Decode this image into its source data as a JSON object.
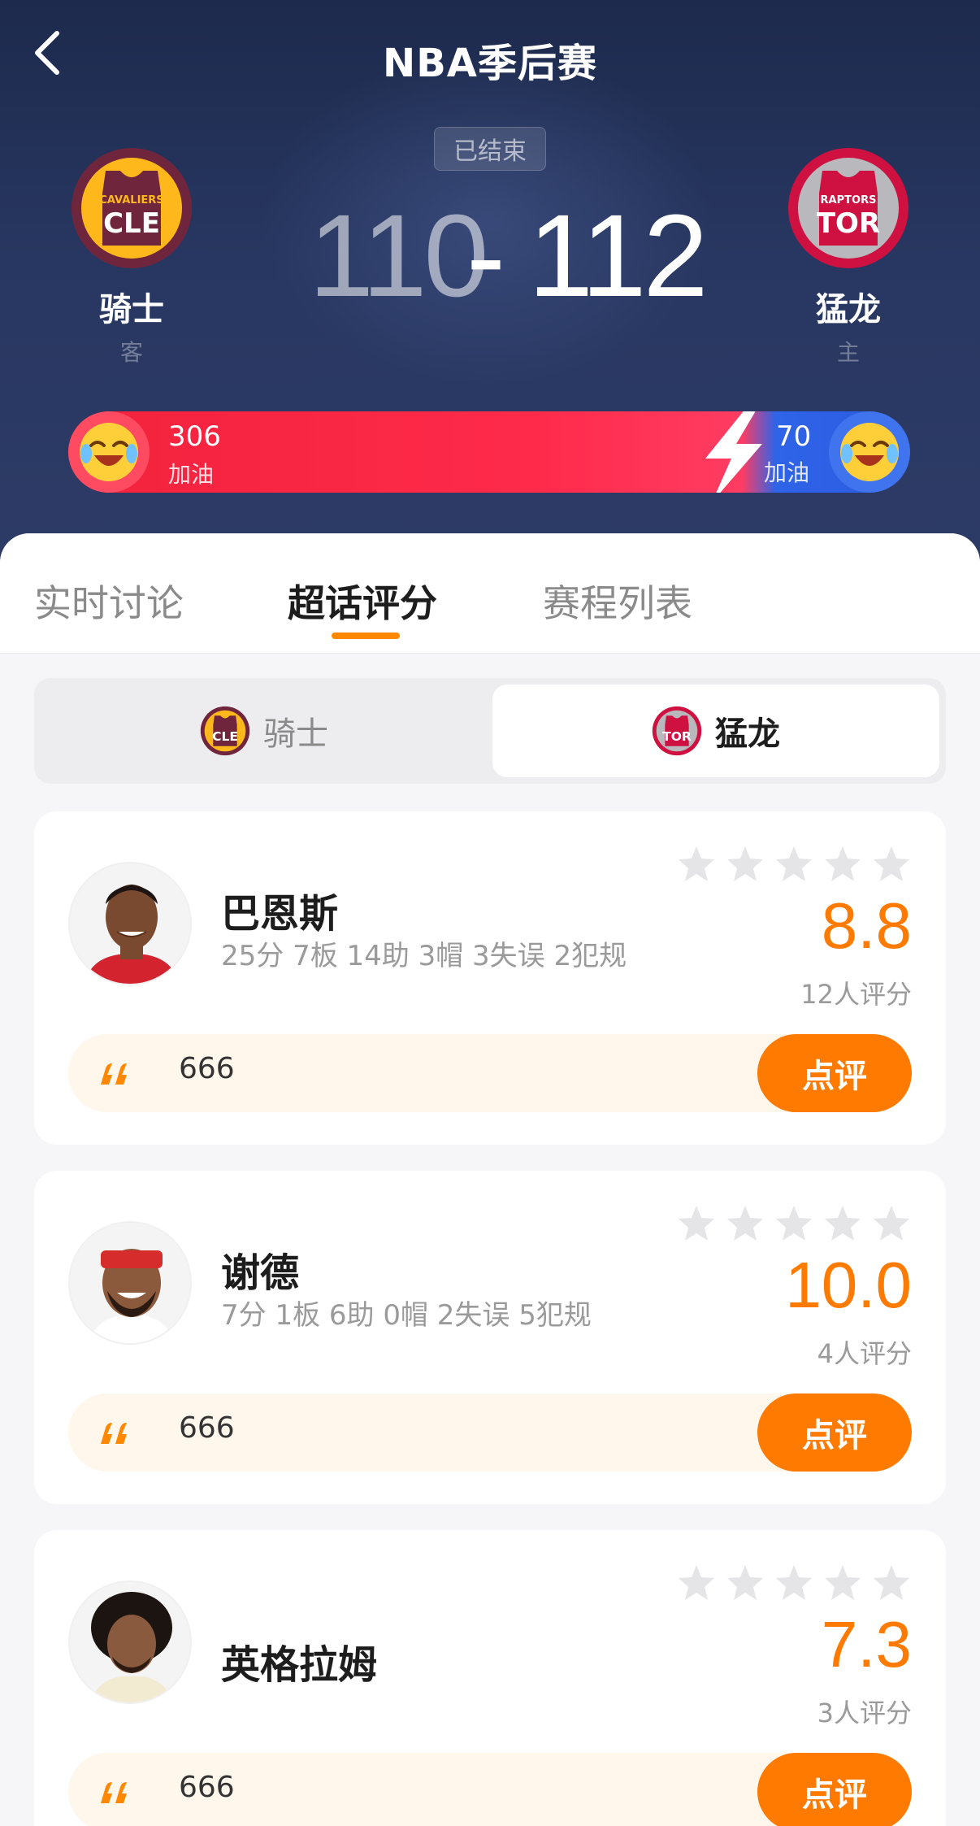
{
  "header": {
    "title": "NBA季后赛",
    "status": "已结束",
    "score": {
      "away": "110",
      "dash": "-",
      "home": "112"
    }
  },
  "teams": {
    "away": {
      "name": "骑士",
      "role": "客",
      "logo_top": "CAVALIERS",
      "logo_abbr": "CLE",
      "color": "#6f263d",
      "accent": "#ffb81c"
    },
    "home": {
      "name": "猛龙",
      "role": "主",
      "logo_top": "RAPTORS",
      "logo_abbr": "TOR",
      "color": "#ce1141",
      "accent": "#a1a1a4"
    }
  },
  "support": {
    "away_count": "306",
    "away_label": "加油",
    "home_count": "70",
    "home_label": "加油",
    "away_color": "#f2223c",
    "home_color": "#2f63e8"
  },
  "tabs": [
    {
      "label": "实时讨论"
    },
    {
      "label": "超话评分"
    },
    {
      "label": "赛程列表"
    }
  ],
  "team_switch": {
    "away_label": "骑士",
    "home_label": "猛龙",
    "selected": "home"
  },
  "players": [
    {
      "name": "巴恩斯",
      "stats": "25分 7板 14助 3帽 3失误 2犯规",
      "rating": "8.8",
      "rating_count": "12人评分",
      "comment": "666",
      "button": "点评"
    },
    {
      "name": "谢德",
      "stats": "7分 1板 6助 0帽 2失误 5犯规",
      "rating": "10.0",
      "rating_count": "4人评分",
      "comment": "666",
      "button": "点评"
    },
    {
      "name": "英格拉姆",
      "stats": "",
      "rating": "7.3",
      "rating_count": "3人评分",
      "comment": "666",
      "button": "点评"
    }
  ],
  "colors": {
    "accent": "#ff7a00",
    "tab_indicator": "#ff8800",
    "header_bg": "#1d2a4d"
  }
}
